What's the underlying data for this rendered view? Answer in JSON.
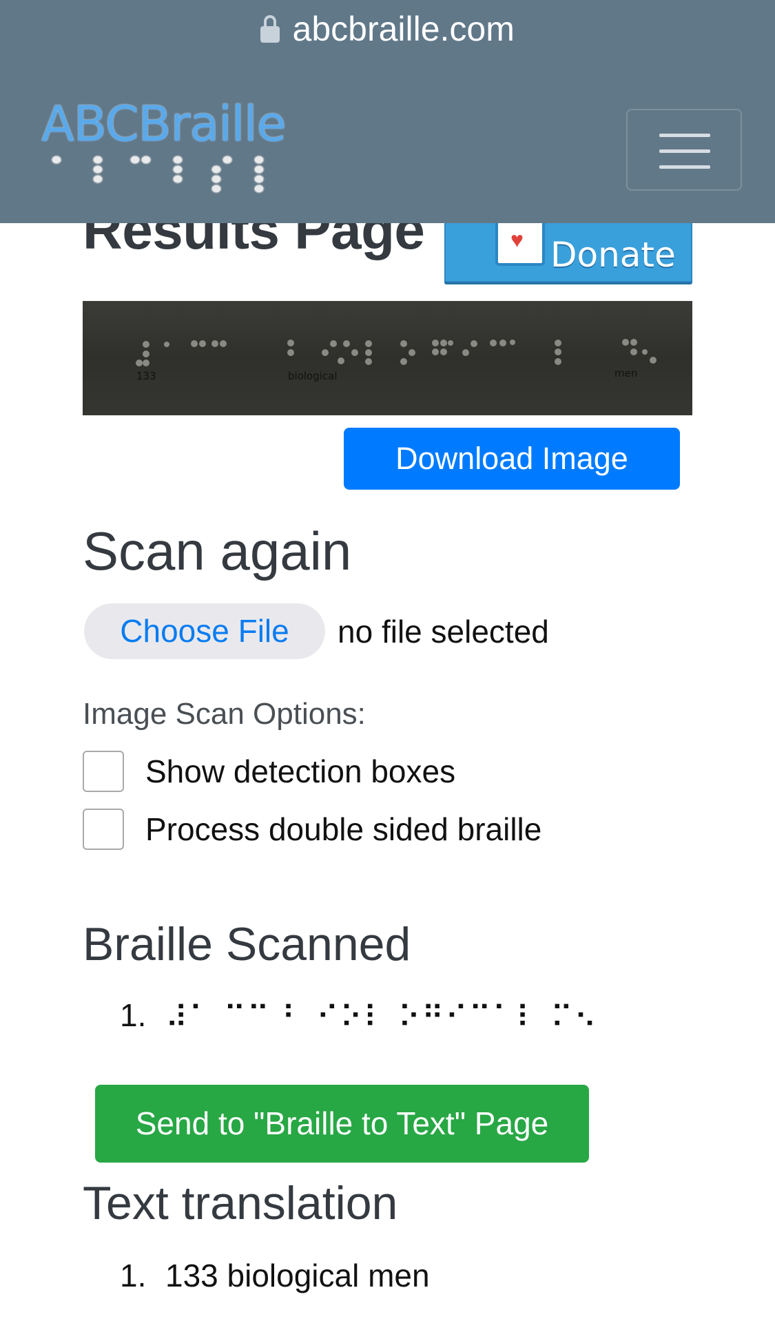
{
  "browser": {
    "url": "abcbraille.com"
  },
  "header": {
    "logo_text": "ABCBraille",
    "menu_icon": "hamburger-menu-icon"
  },
  "page": {
    "title": "Results Page",
    "donate_label": "Donate",
    "image_labels": [
      "133",
      "biological",
      "men"
    ],
    "download_label": "Download Image"
  },
  "scan_again": {
    "heading": "Scan again",
    "choose_file_label": "Choose File",
    "file_status": "no file selected",
    "options_label": "Image Scan Options:",
    "options": [
      {
        "label": "Show detection boxes",
        "checked": false
      },
      {
        "label": "Process double sided braille",
        "checked": false
      }
    ]
  },
  "braille_scanned": {
    "heading": "Braille Scanned",
    "items": [
      {
        "number": "1.",
        "text": "⠼⠁ ⠉⠉ ⠃ ⠊⠕⠇ ⠕⠛⠊⠉⠁⠇ ⠍⠢"
      }
    ],
    "send_label": "Send to \"Braille to Text\" Page"
  },
  "translation": {
    "heading": "Text translation",
    "items": [
      {
        "number": "1.",
        "text": "133 biological men"
      }
    ]
  },
  "colors": {
    "header_bg": "#617889",
    "download_btn": "#007bff",
    "send_btn": "#28a745",
    "donate_btn": "#3aa0db"
  }
}
